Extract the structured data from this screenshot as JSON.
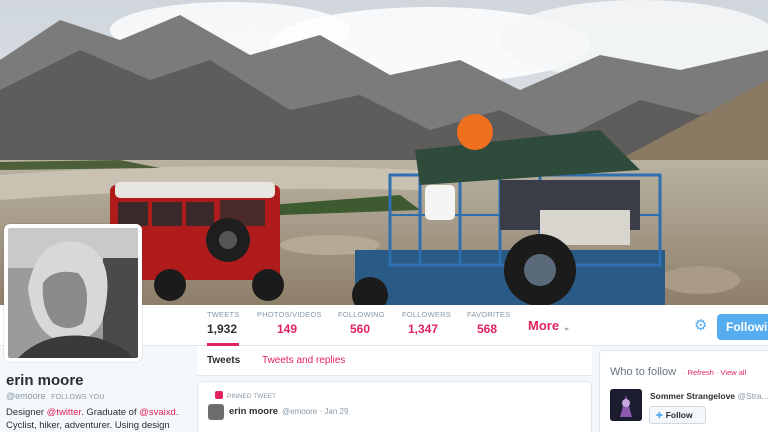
{
  "header_image": {
    "description_icon": "header-photo"
  },
  "stats": [
    {
      "label": "TWEETS",
      "value": "1,932"
    },
    {
      "label": "PHOTOS/VIDEOS",
      "value": "149"
    },
    {
      "label": "FOLLOWING",
      "value": "560"
    },
    {
      "label": "FOLLOWERS",
      "value": "1,347"
    },
    {
      "label": "FAVORITES",
      "value": "568"
    }
  ],
  "more_label": "More",
  "follow_label": "Following",
  "profile": {
    "name": "erin moore",
    "handle": "@emoore",
    "follows_you": "FOLLOWS YOU",
    "bio_1": "Designer ",
    "bio_link_1": "@twitter",
    "bio_2": ". Graduate of ",
    "bio_link_2": "@svaixd",
    "bio_3": ".",
    "bio_line2": "Cyclist, hiker, adventurer. Using design"
  },
  "tabs": {
    "tweets": "Tweets",
    "replies": "Tweets and replies"
  },
  "tweet": {
    "pinned": "PINNED TWEET",
    "name": "erin moore",
    "handle": "@emoore",
    "dot": "·",
    "date": "Jan 29"
  },
  "who_to_follow": {
    "title": "Who to follow",
    "sep": " · ",
    "refresh": "Refresh",
    "view_all": "View all",
    "suggestion_name": "Sommer Strangelove",
    "suggestion_handle": "@Stra...",
    "follow": "Follow"
  },
  "colors": {
    "accent": "#e0245e",
    "blue": "#55acee"
  }
}
